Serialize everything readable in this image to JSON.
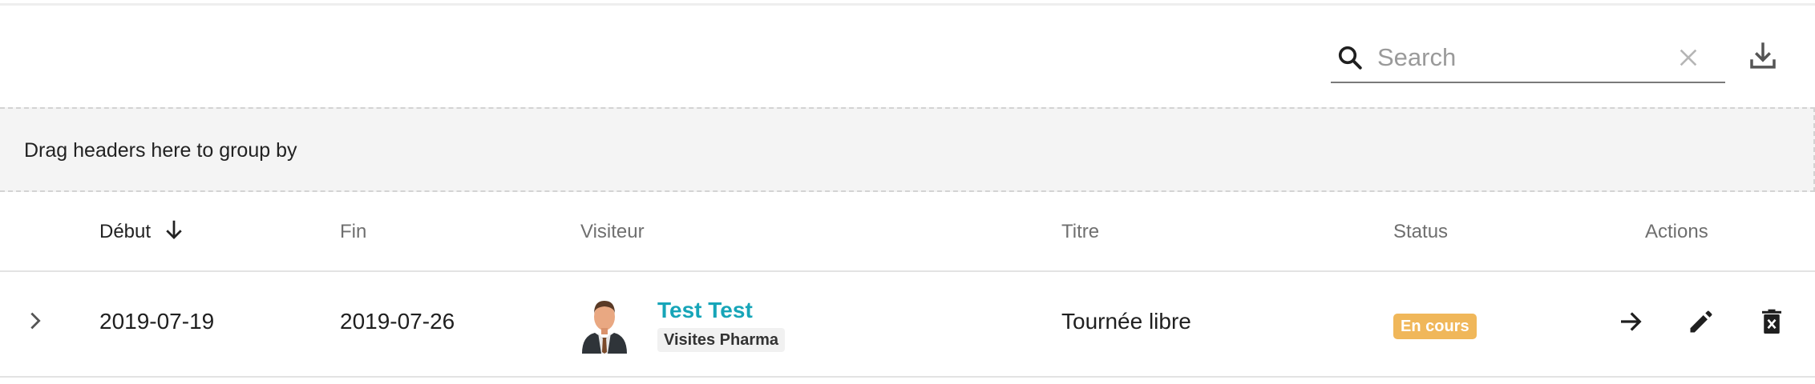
{
  "toolbar": {
    "search_placeholder": "Search",
    "search_value": "",
    "search_icon": "search-icon",
    "clear_icon": "close-icon",
    "download_icon": "download-icon"
  },
  "group_by": {
    "text": "Drag headers here to group by"
  },
  "table": {
    "columns": [
      {
        "label": "Début",
        "sorted": "desc"
      },
      {
        "label": "Fin"
      },
      {
        "label": "Visiteur"
      },
      {
        "label": "Titre"
      },
      {
        "label": "Status"
      },
      {
        "label": "Actions"
      }
    ],
    "rows": [
      {
        "debut": "2019-07-19",
        "fin": "2019-07-26",
        "visiteur": {
          "name": "Test Test",
          "group": "Visites Pharma"
        },
        "titre": "Tournée libre",
        "status": "En cours",
        "actions": [
          "arrow-right-icon",
          "pencil-icon",
          "delete-icon"
        ]
      }
    ]
  },
  "colors": {
    "link": "#17a5b8",
    "status_badge": "#f0b75a",
    "band": "#f4f4f4"
  }
}
